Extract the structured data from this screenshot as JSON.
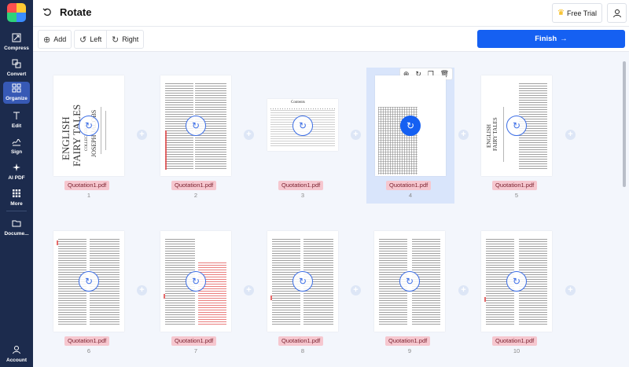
{
  "sidebar": {
    "items": [
      {
        "label": "Compress",
        "icon": "compress-icon"
      },
      {
        "label": "Convert",
        "icon": "convert-icon"
      },
      {
        "label": "Organize",
        "icon": "organize-icon",
        "active": true
      },
      {
        "label": "Edit",
        "icon": "edit-icon"
      },
      {
        "label": "Sign",
        "icon": "sign-icon"
      },
      {
        "label": "AI PDF",
        "icon": "ai-pdf-icon"
      },
      {
        "label": "More",
        "icon": "more-icon"
      },
      {
        "label": "Docume...",
        "icon": "documents-icon"
      }
    ],
    "account_label": "Account"
  },
  "header": {
    "title": "Rotate",
    "trial_label": "Free Trial"
  },
  "toolbar": {
    "add_label": "Add",
    "left_label": "Left",
    "right_label": "Right",
    "finish_label": "Finish"
  },
  "cover": {
    "title1": "ENGLISH",
    "title2": "FAIRY TALES",
    "author": "JOSEPH JACOBS",
    "small": "COLLECTED BY"
  },
  "page3_heading": "Contents",
  "pages": [
    {
      "file": "Quotation1.pdf",
      "number": "1"
    },
    {
      "file": "Quotation1.pdf",
      "number": "2"
    },
    {
      "file": "Quotation1.pdf",
      "number": "3"
    },
    {
      "file": "Quotation1.pdf",
      "number": "4",
      "selected": true
    },
    {
      "file": "Quotation1.pdf",
      "number": "5"
    },
    {
      "file": "Quotation1.pdf",
      "number": "6"
    },
    {
      "file": "Quotation1.pdf",
      "number": "7"
    },
    {
      "file": "Quotation1.pdf",
      "number": "8"
    },
    {
      "file": "Quotation1.pdf",
      "number": "9"
    },
    {
      "file": "Quotation1.pdf",
      "number": "10"
    }
  ],
  "colors": {
    "sidebar": "#1c2b4d",
    "accent": "#1560f2",
    "label_bg": "#f6c7cf",
    "canvas": "#f3f6fc"
  }
}
